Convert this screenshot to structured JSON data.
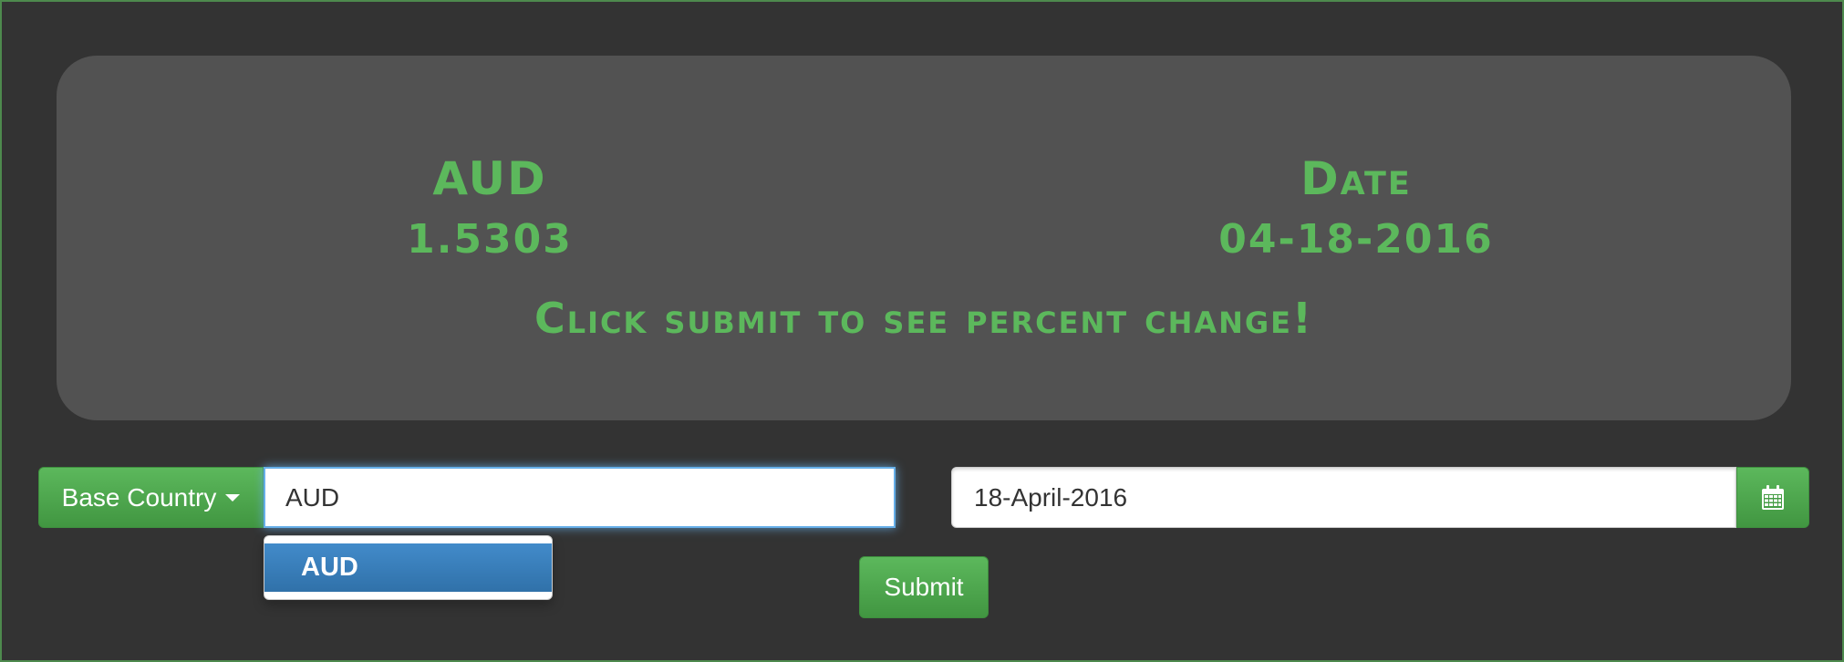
{
  "display": {
    "currency_label": "AUD",
    "currency_value": "1.5303",
    "date_label": "Date",
    "date_value": "04-18-2016",
    "prompt": "Click submit to see percent change!"
  },
  "form": {
    "base_country_label": "Base Country",
    "currency_input_value": "AUD",
    "date_input_value": "18-April-2016",
    "submit_label": "Submit",
    "calendar_icon": "calendar-icon"
  },
  "dropdown": {
    "items": [
      "AUD"
    ]
  },
  "colors": {
    "background": "#333333",
    "panel": "#525252",
    "accent_green": "#5cb85c",
    "highlight_blue": "#3071a9"
  }
}
